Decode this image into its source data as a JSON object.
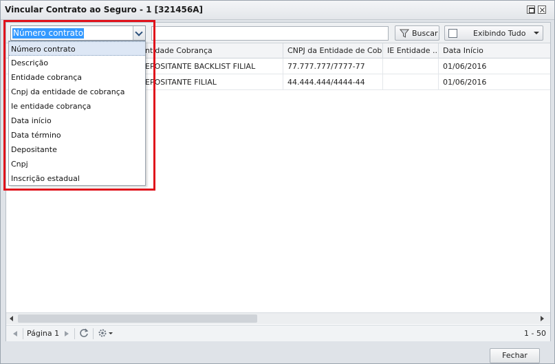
{
  "window": {
    "title": "Vincular Contrato ao Seguro - 1 [321456A]"
  },
  "toolbar": {
    "search_value": "",
    "buscar_label": "Buscar",
    "exibindo_label": "Exibindo Tudo"
  },
  "filter_combo": {
    "selected": "Número contrato",
    "options": [
      "Número contrato",
      "Descrição",
      "Entidade cobrança",
      "Cnpj da entidade de cobrança",
      "Ie entidade cobrança",
      "Data início",
      "Data término",
      "Depositante",
      "Cnpj",
      "Inscrição estadual"
    ]
  },
  "grid": {
    "columns": [
      "ntidade Cobrança",
      "CNPJ da Entidade de Cob...",
      "IE Entidade ...",
      "Data Início"
    ],
    "rows": [
      [
        "EPOSITANTE BACKLIST FILIAL",
        "77.777.777/7777-77",
        "",
        "01/06/2016"
      ],
      [
        "EPOSITANTE FILIAL",
        "44.444.444/4444-44",
        "",
        "01/06/2016"
      ]
    ]
  },
  "pager": {
    "page_label": "Página 1",
    "range": "1 - 50"
  },
  "footer": {
    "close_label": "Fechar"
  },
  "colors": {
    "highlight": "#e0111b",
    "selection": "#3399ff"
  }
}
